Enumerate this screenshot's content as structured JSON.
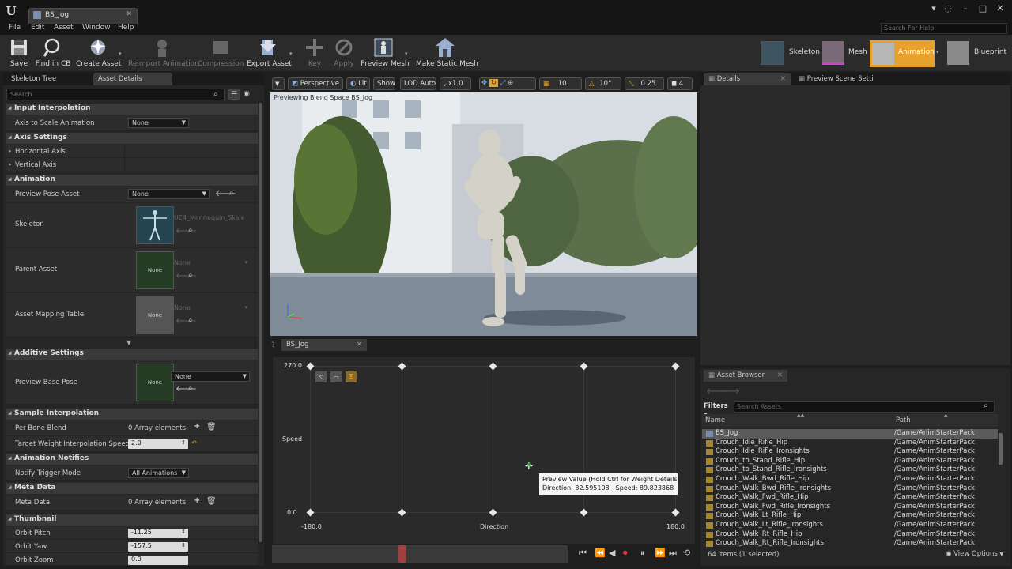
{
  "window": {
    "tab_title": "BS_Jog"
  },
  "menu": [
    "File",
    "Edit",
    "Asset",
    "Window",
    "Help"
  ],
  "search_help_placeholder": "Search For Help",
  "toolbar": [
    {
      "label": "Save",
      "enabled": true
    },
    {
      "label": "Find in CB",
      "enabled": true
    },
    {
      "label": "Create Asset",
      "enabled": true
    },
    {
      "label": "Reimport Animation",
      "enabled": false
    },
    {
      "label": "Compression",
      "enabled": false
    },
    {
      "label": "Export Asset",
      "enabled": true
    },
    {
      "label": "Key",
      "enabled": false
    },
    {
      "label": "Apply",
      "enabled": false
    },
    {
      "label": "Preview Mesh",
      "enabled": true
    },
    {
      "label": "Make Static Mesh",
      "enabled": true
    }
  ],
  "modes": {
    "skeleton": "Skeleton",
    "mesh": "Mesh",
    "animation": "Animation",
    "blueprint": "Blueprint",
    "active": "Animation"
  },
  "left_panel": {
    "tabs": [
      "Skeleton Tree",
      "Asset Details"
    ],
    "search_placeholder": "Search",
    "input_interpolation": {
      "title": "Input Interpolation",
      "axis_to_scale_label": "Axis to Scale Animation",
      "axis_to_scale_value": "None"
    },
    "axis_settings": {
      "title": "Axis Settings",
      "horizontal": "Horizontal Axis",
      "vertical": "Vertical Axis"
    },
    "animation": {
      "title": "Animation",
      "preview_pose_label": "Preview Pose Asset",
      "preview_pose_value": "None",
      "skeleton_label": "Skeleton",
      "skeleton_value": "UE4_Mannequin_Skele",
      "parent_label": "Parent Asset",
      "parent_value": "None",
      "parent_thumb": "None",
      "mapping_label": "Asset Mapping Table",
      "mapping_value": "None",
      "mapping_thumb": "None"
    },
    "additive": {
      "title": "Additive Settings",
      "base_pose_label": "Preview Base Pose",
      "base_pose_value": "None",
      "base_pose_thumb": "None"
    },
    "sample_interp": {
      "title": "Sample Interpolation",
      "per_bone_label": "Per Bone Blend",
      "per_bone_value": "0 Array elements",
      "target_weight_label": "Target Weight Interpolation Speed Per",
      "target_weight_value": "2.0"
    },
    "notifies": {
      "title": "Animation Notifies",
      "mode_label": "Notify Trigger Mode",
      "mode_value": "All Animations"
    },
    "meta": {
      "title": "Meta Data",
      "label": "Meta Data",
      "value": "0 Array elements"
    },
    "thumbnail": {
      "title": "Thumbnail",
      "pitch_label": "Orbit Pitch",
      "pitch_value": "-11.25",
      "yaw_label": "Orbit Yaw",
      "yaw_value": "-157.5",
      "zoom_label": "Orbit Zoom",
      "zoom_value": "0.0"
    }
  },
  "viewport": {
    "perspective": "Perspective",
    "lit": "Lit",
    "show": "Show",
    "lod": "LOD Auto",
    "speed": "x1.0",
    "grid_snap": "10",
    "rot_snap": "10°",
    "scale_snap": "0.25",
    "cam_speed": "4",
    "overlay": "Previewing Blend Space BS_Jog"
  },
  "blend_space": {
    "tab": "BS_Jog",
    "y_label": "Speed",
    "y_max": "270.0",
    "y_min": "0.0",
    "x_label": "Direction",
    "x_min": "-180.0",
    "x_max": "180.0",
    "tooltip_title": "Preview Value (Hold Ctrl for Weight Details)",
    "tooltip_value": "Direction: 32.595108 - Speed: 89.823868"
  },
  "right_panel": {
    "tabs": [
      "Details",
      "Preview Scene Setti"
    ]
  },
  "asset_browser": {
    "tab": "Asset Browser",
    "filters": "Filters",
    "search_placeholder": "Search Assets",
    "col_name": "Name",
    "col_path": "Path",
    "items": [
      {
        "name": "BS_Jog",
        "path": "/Game/AnimStarterPack",
        "selected": true
      },
      {
        "name": "Crouch_Idle_Rifle_Hip",
        "path": "/Game/AnimStarterPack"
      },
      {
        "name": "Crouch_Idle_Rifle_Ironsights",
        "path": "/Game/AnimStarterPack"
      },
      {
        "name": "Crouch_to_Stand_Rifle_Hip",
        "path": "/Game/AnimStarterPack"
      },
      {
        "name": "Crouch_to_Stand_Rifle_Ironsights",
        "path": "/Game/AnimStarterPack"
      },
      {
        "name": "Crouch_Walk_Bwd_Rifle_Hip",
        "path": "/Game/AnimStarterPack"
      },
      {
        "name": "Crouch_Walk_Bwd_Rifle_Ironsights",
        "path": "/Game/AnimStarterPack"
      },
      {
        "name": "Crouch_Walk_Fwd_Rifle_Hip",
        "path": "/Game/AnimStarterPack"
      },
      {
        "name": "Crouch_Walk_Fwd_Rifle_Ironsights",
        "path": "/Game/AnimStarterPack"
      },
      {
        "name": "Crouch_Walk_Lt_Rifle_Hip",
        "path": "/Game/AnimStarterPack"
      },
      {
        "name": "Crouch_Walk_Lt_Rifle_Ironsights",
        "path": "/Game/AnimStarterPack"
      },
      {
        "name": "Crouch_Walk_Rt_Rifle_Hip",
        "path": "/Game/AnimStarterPack"
      },
      {
        "name": "Crouch_Walk_Rt_Rifle_Ironsights",
        "path": "/Game/AnimStarterPack"
      }
    ],
    "count": "64 items (1 selected)",
    "view_options": "View Options"
  },
  "colors": {
    "accent": "#e8a12c",
    "bg": "#1e1e1e",
    "panel": "#262626"
  }
}
